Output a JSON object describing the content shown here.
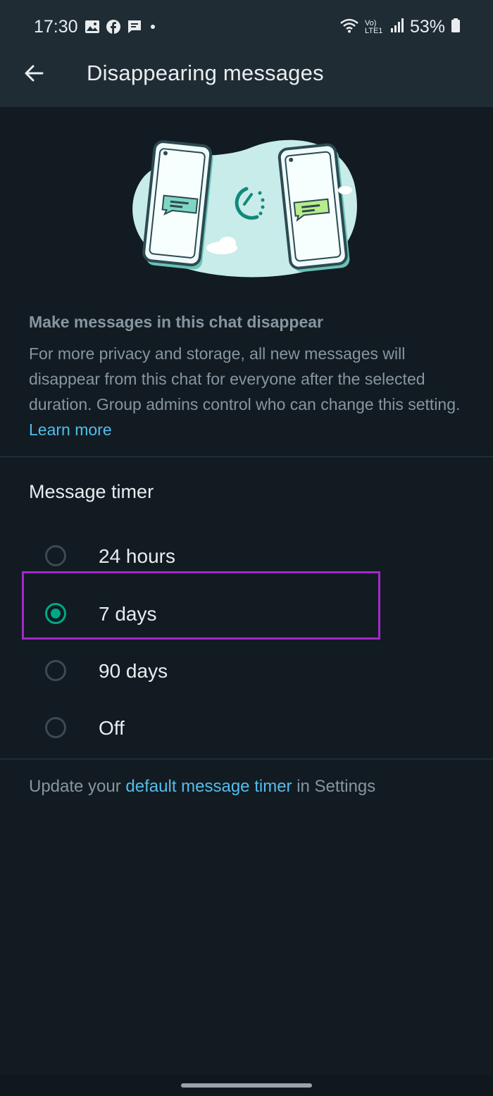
{
  "status_bar": {
    "time": "17:30",
    "left_icons": [
      "image-icon",
      "facebook-icon",
      "message-icon",
      "dot-icon"
    ],
    "right_icons": [
      "wifi-icon",
      "volte-icon",
      "signal-icon",
      "battery-icon"
    ],
    "volte_text": "Vo) LTE1",
    "battery": "53%"
  },
  "app_bar": {
    "back_icon": "arrow-left-icon",
    "title": "Disappearing messages"
  },
  "info": {
    "headline": "Make messages in this chat disappear",
    "description": "For more privacy and storage, all new messages will disappear from this chat for everyone after the selected duration. Group admins control who can change this setting.",
    "learn_more": "Learn more"
  },
  "timer": {
    "title": "Message timer",
    "options": [
      {
        "label": "24 hours",
        "selected": false
      },
      {
        "label": "7 days",
        "selected": true
      },
      {
        "label": "90 days",
        "selected": false
      },
      {
        "label": "Off",
        "selected": false
      }
    ]
  },
  "footer": {
    "prefix": "Update your",
    "link": "default message timer",
    "suffix": "in Settings"
  },
  "colors": {
    "background": "#121b22",
    "app_bar": "#1f2c34",
    "accent": "#00a884",
    "link": "#53bdeb",
    "highlight_box": "#a329c9"
  }
}
